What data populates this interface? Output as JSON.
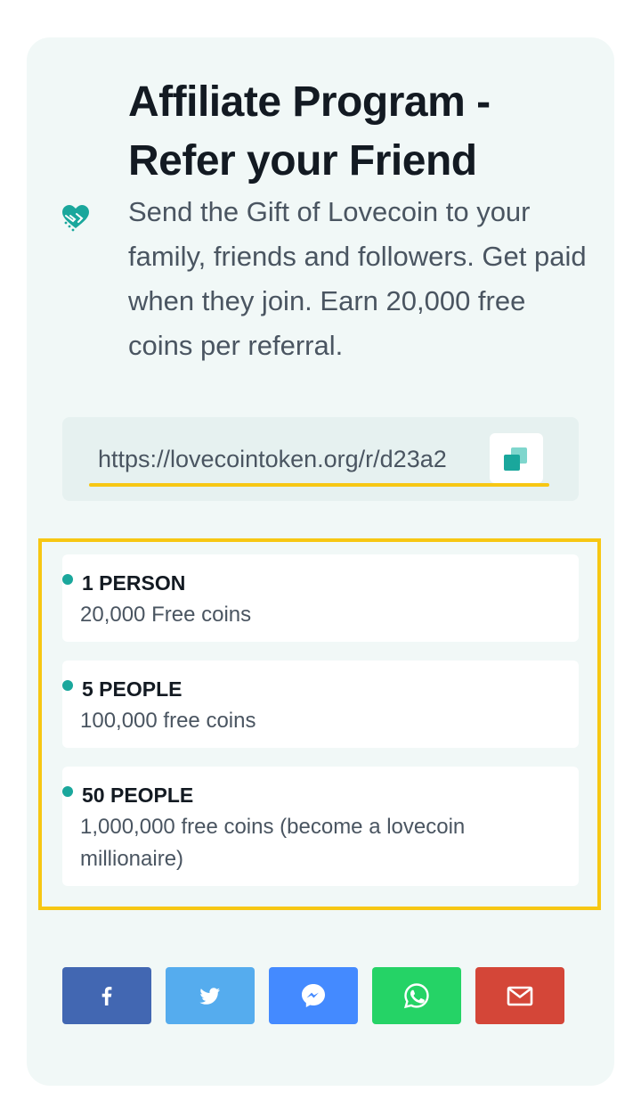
{
  "header": {
    "title_line1": "Affiliate Program -",
    "title_line2": "Refer your Friend",
    "description": "Send the Gift of Lovecoin to your family, friends and followers. Get paid when they join. Earn 20,000 free coins per referral.",
    "icon": "handshake-heart-icon"
  },
  "referral": {
    "link": "https://lovecointoken.org/r/d23a2",
    "copy_icon": "copy-icon"
  },
  "tiers": [
    {
      "heading": "1 PERSON",
      "reward": "20,000 Free coins"
    },
    {
      "heading": "5 PEOPLE",
      "reward": "100,000 free coins"
    },
    {
      "heading": "50 PEOPLE",
      "reward": "1,000,000 free coins (become a lovecoin millionaire)"
    }
  ],
  "share": [
    {
      "network": "facebook",
      "icon": "facebook-icon",
      "color": "#4267b2"
    },
    {
      "network": "twitter",
      "icon": "twitter-icon",
      "color": "#55acee"
    },
    {
      "network": "messenger",
      "icon": "messenger-icon",
      "color": "#448aff"
    },
    {
      "network": "whatsapp",
      "icon": "whatsapp-icon",
      "color": "#25d366"
    },
    {
      "network": "email",
      "icon": "mail-icon",
      "color": "#d44638"
    }
  ],
  "colors": {
    "accent": "#1aa79c",
    "highlight": "#f7c713",
    "card_background": "#f1f8f7"
  }
}
